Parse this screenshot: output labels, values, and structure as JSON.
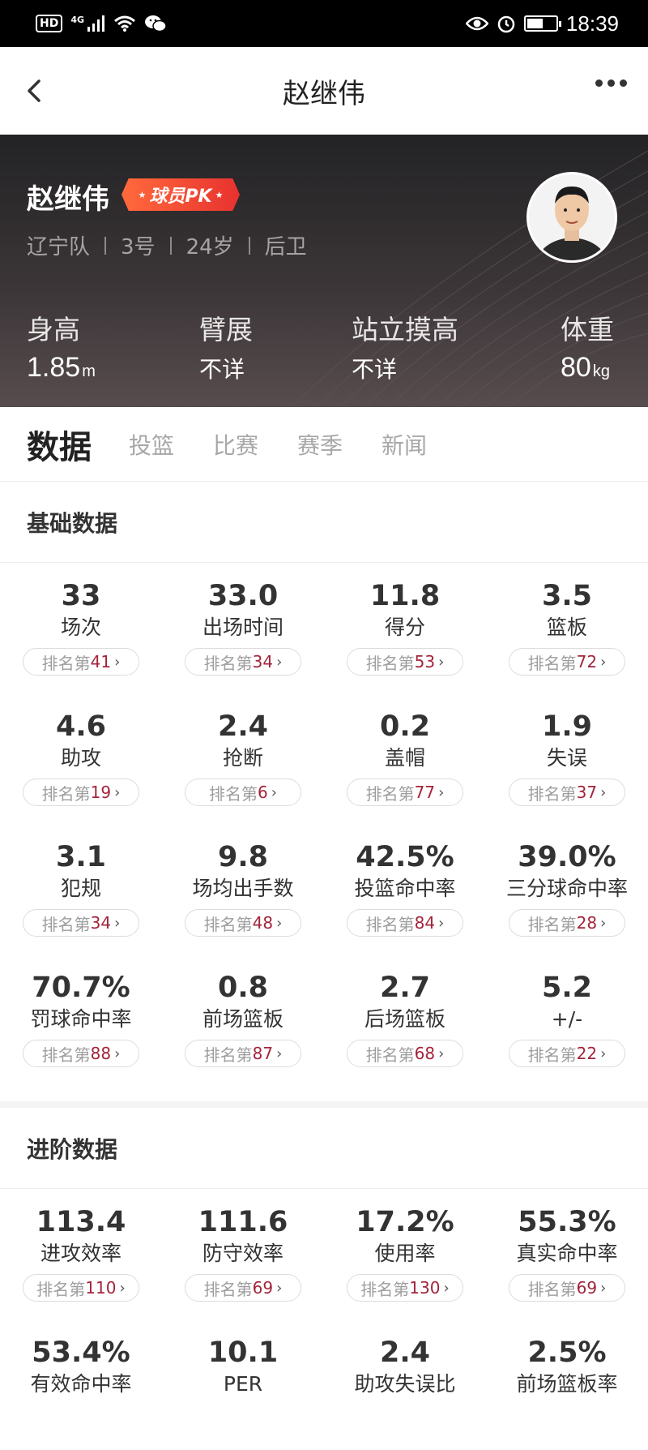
{
  "status_bar": {
    "hd": "HD",
    "network": "4G",
    "time": "18:39",
    "battery_level": 0.55
  },
  "nav": {
    "title": "赵继伟"
  },
  "player": {
    "name": "赵继伟",
    "pk_label": "球员PK",
    "team": "辽宁队",
    "number": "3号",
    "age": "24岁",
    "position": "后卫",
    "height_label": "身高",
    "height_value": "1.85",
    "height_unit": "m",
    "wingspan_label": "臂展",
    "wingspan_value": "不详",
    "reach_label": "站立摸高",
    "reach_value": "不详",
    "weight_label": "体重",
    "weight_value": "80",
    "weight_unit": "kg"
  },
  "tabs": [
    "数据",
    "投篮",
    "比赛",
    "赛季",
    "新闻"
  ],
  "rank_prefix": "排名第",
  "basic": {
    "title": "基础数据",
    "stats": [
      {
        "value": "33",
        "label": "场次",
        "rank": "41"
      },
      {
        "value": "33.0",
        "label": "出场时间",
        "rank": "34"
      },
      {
        "value": "11.8",
        "label": "得分",
        "rank": "53"
      },
      {
        "value": "3.5",
        "label": "篮板",
        "rank": "72"
      },
      {
        "value": "4.6",
        "label": "助攻",
        "rank": "19"
      },
      {
        "value": "2.4",
        "label": "抢断",
        "rank": "6"
      },
      {
        "value": "0.2",
        "label": "盖帽",
        "rank": "77"
      },
      {
        "value": "1.9",
        "label": "失误",
        "rank": "37"
      },
      {
        "value": "3.1",
        "label": "犯规",
        "rank": "34"
      },
      {
        "value": "9.8",
        "label": "场均出手数",
        "rank": "48"
      },
      {
        "value": "42.5%",
        "label": "投篮命中率",
        "rank": "84"
      },
      {
        "value": "39.0%",
        "label": "三分球命中率",
        "rank": "28"
      },
      {
        "value": "70.7%",
        "label": "罚球命中率",
        "rank": "88"
      },
      {
        "value": "0.8",
        "label": "前场篮板",
        "rank": "87"
      },
      {
        "value": "2.7",
        "label": "后场篮板",
        "rank": "68"
      },
      {
        "value": "5.2",
        "label": "+/-",
        "rank": "22"
      }
    ]
  },
  "advanced": {
    "title": "进阶数据",
    "stats": [
      {
        "value": "113.4",
        "label": "进攻效率",
        "rank": "110"
      },
      {
        "value": "111.6",
        "label": "防守效率",
        "rank": "69"
      },
      {
        "value": "17.2%",
        "label": "使用率",
        "rank": "130"
      },
      {
        "value": "55.3%",
        "label": "真实命中率",
        "rank": "69"
      },
      {
        "value": "53.4%",
        "label": "有效命中率",
        "rank": null
      },
      {
        "value": "10.1",
        "label": "PER",
        "rank": null
      },
      {
        "value": "2.4",
        "label": "助攻失误比",
        "rank": null
      },
      {
        "value": "2.5%",
        "label": "前场篮板率",
        "rank": null
      }
    ]
  }
}
